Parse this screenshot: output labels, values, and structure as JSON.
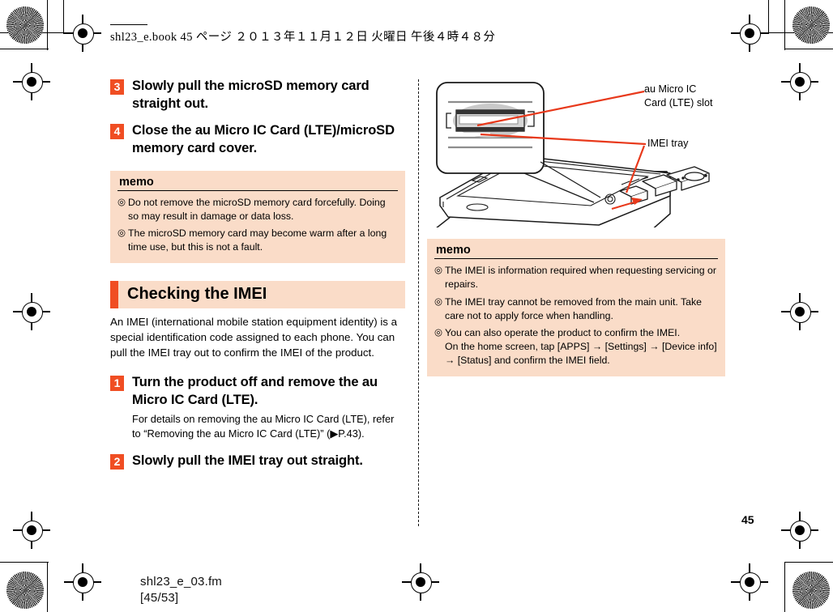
{
  "print_slug": "shl23_e.book   45 ページ   ２０１３年１１月１２日   火曜日   午後４時４８分",
  "left_column": {
    "steps_top": [
      {
        "num": "3",
        "title": "Slowly pull the microSD memory card straight out."
      },
      {
        "num": "4",
        "title": "Close the au Micro IC Card (LTE)/microSD memory card cover."
      }
    ],
    "memo": {
      "heading": "memo",
      "bullet": "◎",
      "items": [
        "Do not remove the microSD memory card forcefully. Doing so may result in damage or data loss.",
        "The microSD memory card may become warm after a long time use, but this is not a fault."
      ]
    },
    "section": {
      "title": "Checking the IMEI",
      "body": "An IMEI (international mobile station equipment identity) is a special identification code assigned to each phone. You can pull the IMEI tray out to confirm the IMEI of the product."
    },
    "steps_bottom": [
      {
        "num": "1",
        "title": "Turn the product off and remove the au Micro IC Card (LTE).",
        "note": "For details on removing the au Micro IC Card (LTE), refer to “Removing the au Micro IC Card (LTE)” (▶P.43)."
      },
      {
        "num": "2",
        "title": "Slowly pull the IMEI tray out straight.",
        "note": ""
      }
    ]
  },
  "right_column": {
    "diagram": {
      "callout_slot": "au Micro IC\nCard (LTE) slot",
      "callout_tray": "IMEI tray"
    },
    "memo": {
      "heading": "memo",
      "bullet": "◎",
      "items": [
        {
          "text": "The IMEI is information required when requesting servicing or repairs.",
          "sub": ""
        },
        {
          "text": "The IMEI tray cannot be removed from the main unit. Take care not to apply force when handling.",
          "sub": ""
        },
        {
          "text": "You can also operate the product to confirm the IMEI.",
          "sub": "On the home screen, tap [APPS] → [Settings] → [Device info] → [Status] and confirm the IMEI field."
        }
      ]
    }
  },
  "page_number": "45",
  "footer": {
    "filename": "shl23_e_03.fm",
    "pagination": "[45/53]"
  },
  "colors": {
    "accent": "#f04e23",
    "memo_bg": "#fadcc8",
    "callout_line": "#e8391b"
  }
}
